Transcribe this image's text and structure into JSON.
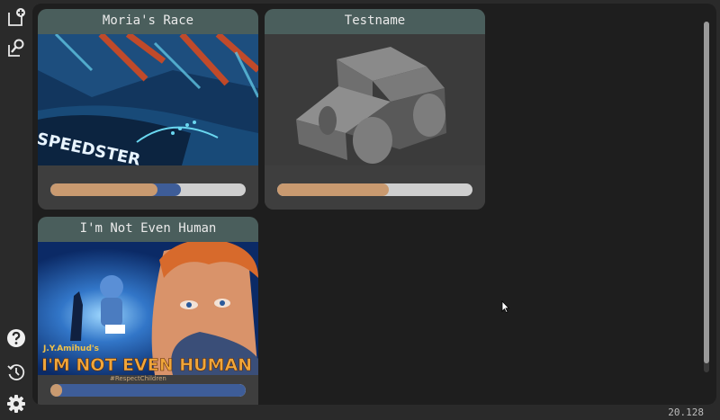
{
  "sidebar": {
    "new_project_icon": "new-project-icon",
    "find_project_icon": "find-project-icon",
    "help_icon": "help-icon",
    "history_icon": "history-icon",
    "settings_icon": "settings-icon"
  },
  "projects": [
    {
      "title": "Moria's Race",
      "primary_progress": 0.55,
      "secondary_progress": 0.67,
      "cover_text": "SPEEDSTER"
    },
    {
      "title": "Testname",
      "primary_progress": 0.57,
      "secondary_progress": 0
    },
    {
      "title": "I'm Not Even Human",
      "primary_progress": 0.06,
      "secondary_progress": 1.0,
      "cover_author": "J.Y.Amihud's",
      "cover_title": "I'M NOT EVEN HUMAN",
      "cover_tag": "#RespectChildren"
    }
  ],
  "colors": {
    "accent_primary": "#c99a70",
    "accent_secondary": "#3e5d98",
    "title_bar": "#4a5e5c"
  },
  "footer": {
    "version": "20.128"
  }
}
